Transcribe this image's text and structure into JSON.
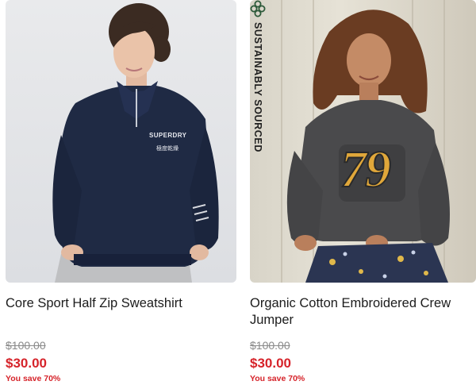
{
  "products": [
    {
      "name": "Core Sport Half Zip Sweatshirt",
      "original_price": "$100.00",
      "sale_price": "$30.00",
      "savings": "You save 70%",
      "chest_logo": "SUPERDRY",
      "chest_logo_sub": "極度乾燥"
    },
    {
      "name": "Organic Cotton Embroidered Crew Jumper",
      "original_price": "$100.00",
      "sale_price": "$30.00",
      "savings": "You save 70%",
      "badge": "SUSTAINABLY SOURCED",
      "badge_icon": "leaf-flower-icon",
      "graphic_text": "79"
    }
  ],
  "colors": {
    "sale": "#d6232a",
    "strike": "#8a8a8a",
    "sweatshirt": "#1f2a44",
    "jumper": "#4a4a4c"
  }
}
